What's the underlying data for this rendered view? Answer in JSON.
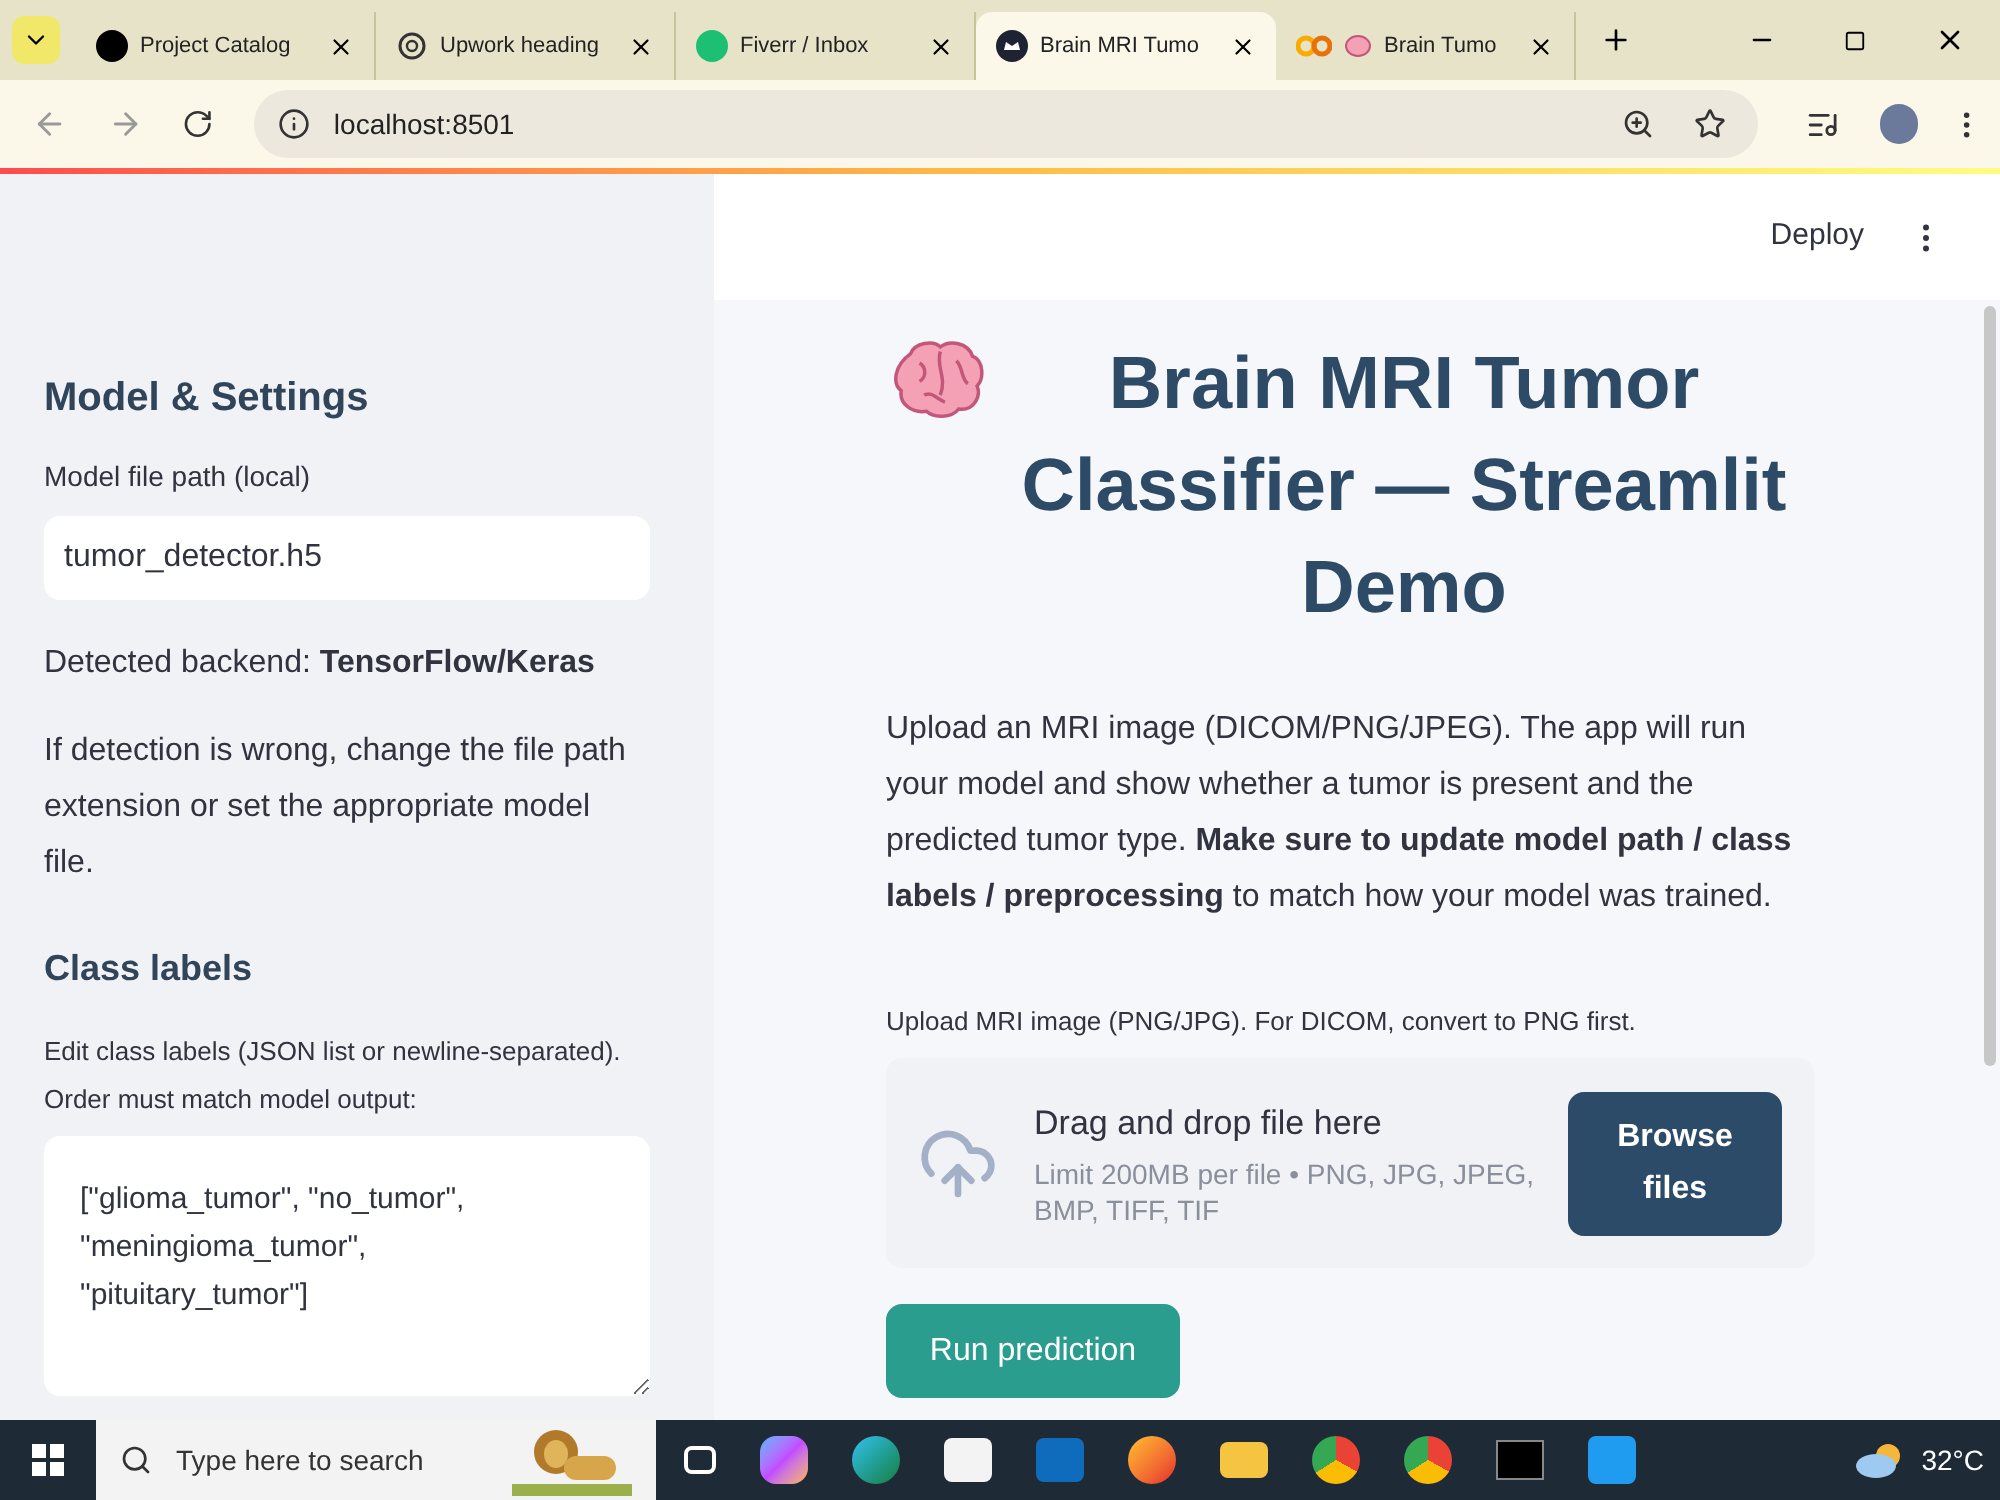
{
  "browser": {
    "tabs": [
      {
        "title": "Project Catalog",
        "selected": false
      },
      {
        "title": "Upwork heading",
        "selected": false
      },
      {
        "title": "Fiverr / Inbox",
        "selected": false
      },
      {
        "title": "Brain MRI Tumo",
        "selected": true
      },
      {
        "title": "Brain Tumo",
        "selected": false
      }
    ],
    "url": "localhost:8501"
  },
  "sidebar": {
    "heading": "Model & Settings",
    "model_path": {
      "label": "Model file path (local)",
      "value": "tumor_detector.h5"
    },
    "backend_text": "Detected backend: **TensorFlow/Keras**",
    "hint": "If detection is wrong, change the file path extension or set the appropriate model file.",
    "class_heading": "Class labels",
    "class_labels": {
      "label": "Edit class labels (JSON list or newline-separated). Order must match model output:",
      "value": "[\"glioma_tumor\", \"no_tumor\",\n\"meningioma_tumor\",\n\"pituitary_tumor\"]"
    }
  },
  "header": {
    "deploy": "Deploy"
  },
  "main": {
    "title": "Brain MRI Tumor Classifier — Streamlit Demo",
    "intro": "Upload an MRI image (DICOM/PNG/JPEG). The app will run your model and show whether a tumor is present and the predicted tumor type. **Make sure to update model path / class labels / preprocessing** to match how your model was trained.",
    "upload_label": "Upload MRI image (PNG/JPG). For DICOM, convert to PNG first.",
    "dropzone": {
      "title": "Drag and drop file here",
      "limits": "Limit 200MB per file • PNG, JPG, JPEG, BMP, TIFF, TIF",
      "button": "Browse files"
    },
    "run_button": "Run prediction"
  },
  "taskbar": {
    "search_placeholder": "Type here to search",
    "weather": "32°C"
  }
}
